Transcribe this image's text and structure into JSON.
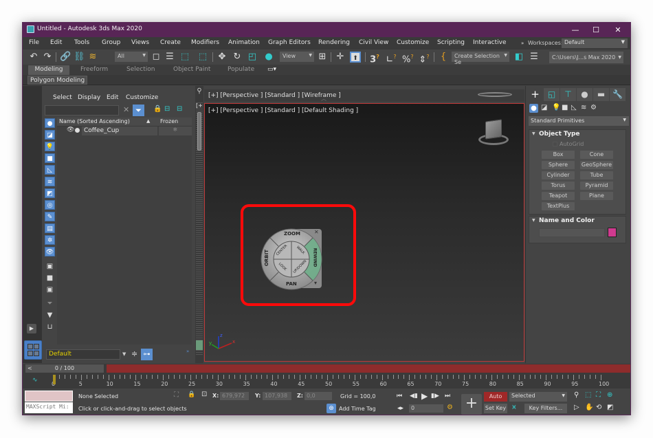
{
  "window": {
    "title": "Untitled - Autodesk 3ds Max 2020",
    "controls": {
      "minimize": "—",
      "maximize": "☐",
      "close": "✕"
    }
  },
  "menu": {
    "items": [
      {
        "label": "File"
      },
      {
        "label": "Edit"
      },
      {
        "label": "Tools"
      },
      {
        "label": "Group"
      },
      {
        "label": "Views"
      },
      {
        "label": "Create"
      },
      {
        "label": "Modifiers"
      },
      {
        "label": "Animation"
      },
      {
        "label": "Graph Editors"
      },
      {
        "label": "Rendering"
      },
      {
        "label": "Civil View"
      },
      {
        "label": "Customize"
      },
      {
        "label": "Scripting"
      },
      {
        "label": "Interactive"
      }
    ],
    "overflow": "»",
    "workspaces_label": "Workspaces:",
    "workspaces_value": "Default"
  },
  "toolbar": {
    "selection_filter": "All",
    "ref_coord": "View",
    "named_selection": "Create Selection Se",
    "project_path": "C:\\Users\\J...s Max 2020",
    "snap_3d": "3"
  },
  "ribbon": {
    "tabs": [
      "Modeling",
      "Freeform",
      "Selection",
      "Object Paint",
      "Populate"
    ],
    "active_tab": "Modeling",
    "sub_panel": "Polygon Modeling"
  },
  "scene_explorer": {
    "tabs": [
      "Select",
      "Display",
      "Edit",
      "Customize"
    ],
    "search_value": "",
    "columns": [
      "Name (Sorted Ascending)",
      "Frozen"
    ],
    "rows": [
      {
        "name": "Coffee_Cup"
      }
    ],
    "layer": "Default"
  },
  "viewports": {
    "top_label": "[+] [Perspective ] [Standard ] [Wireframe ]",
    "main_label": "[+] [Perspective ] [Standard ] [Default Shading ]",
    "side_label": "[+",
    "nav_wheel": {
      "outer": [
        "ZOOM",
        "ORBIT",
        "PAN",
        "REWIND"
      ],
      "inner": [
        "CENTER",
        "WALK",
        "LOOK",
        "UP/DOWN"
      ]
    },
    "axes": {
      "x": "x",
      "y": "y",
      "z": "z"
    }
  },
  "command_panel": {
    "category": "Standard Primitives",
    "object_type_title": "Object Type",
    "autogrid": "AutoGrid",
    "primitives": [
      "Box",
      "Cone",
      "Sphere",
      "GeoSphere",
      "Cylinder",
      "Tube",
      "Torus",
      "Pyramid",
      "Teapot",
      "Plane",
      "TextPlus"
    ],
    "name_color_title": "Name and Color",
    "object_name": "",
    "object_color": "#d03a8f"
  },
  "timeline": {
    "frame_display": "0 / 100",
    "prev": "<",
    "next": ">",
    "ticks": [
      "0",
      "5",
      "10",
      "15",
      "20",
      "25",
      "30",
      "35",
      "40",
      "45",
      "50",
      "55",
      "60",
      "65",
      "70",
      "75",
      "80",
      "85",
      "90",
      "95",
      "100"
    ],
    "current_frame": 0
  },
  "status": {
    "maxscript": "MAXScript Mi:",
    "selection": "None Selected",
    "prompt": "Click or click-and-drag to select objects",
    "x_label": "X:",
    "x_value": "679,972",
    "y_label": "Y:",
    "y_value": "107,938",
    "z_label": "Z:",
    "z_value": "0,0",
    "grid": "Grid = 100,0",
    "add_time_tag": "Add Time Tag",
    "frame_spinner": "0",
    "auto_key": "Auto Key",
    "set_key": "Set Key",
    "key_mode": "Selected",
    "key_filters": "Key Filters..."
  },
  "colors": {
    "title_bar": "#582556",
    "accent_blue": "#5b8fd0",
    "timeline_red": "#8e2c2c",
    "highlight_red": "#ff0a0a",
    "auto_key_red": "#a02828"
  }
}
